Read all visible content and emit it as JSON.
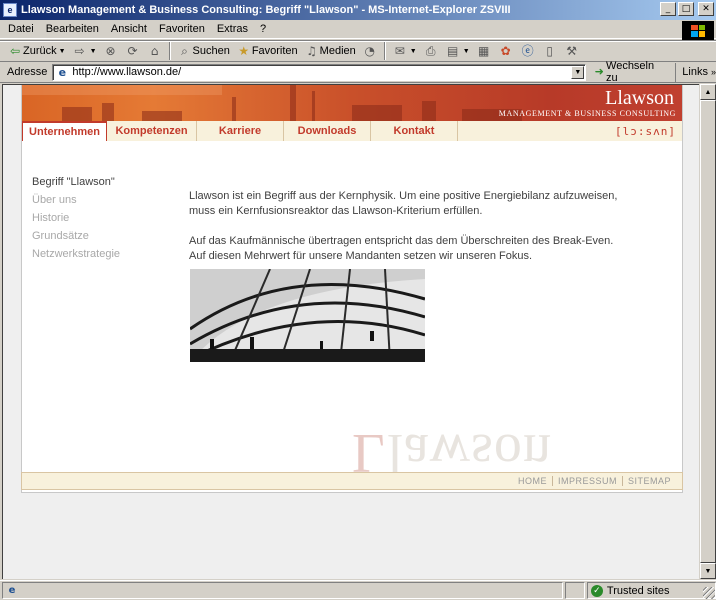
{
  "window": {
    "title": "Llawson Management & Business Consulting: Begriff \"Llawson\" - MS-Internet-Explorer ZSVIII"
  },
  "menu": [
    "Datei",
    "Bearbeiten",
    "Ansicht",
    "Favoriten",
    "Extras",
    "?"
  ],
  "toolbar": {
    "back_label": "Zurück",
    "search_label": "Suchen",
    "favorites_label": "Favoriten",
    "media_label": "Medien"
  },
  "address": {
    "label": "Adresse",
    "url": "http://www.llawson.de/",
    "go_label": "Wechseln zu",
    "links_label": "Links"
  },
  "site": {
    "brand": "Llawson",
    "tagline": "MANAGEMENT & BUSINESS CONSULTING",
    "logo_mark": "[lɔ:sʌn]",
    "nav": [
      {
        "label": "Unternehmen",
        "active": true
      },
      {
        "label": "Kompetenzen",
        "active": false
      },
      {
        "label": "Karriere",
        "active": false
      },
      {
        "label": "Downloads",
        "active": false
      },
      {
        "label": "Kontakt",
        "active": false
      }
    ],
    "subnav": [
      {
        "label": "Begriff \"Llawson\"",
        "current": true
      },
      {
        "label": "Über uns",
        "current": false
      },
      {
        "label": "Historie",
        "current": false
      },
      {
        "label": "Grundsätze",
        "current": false
      },
      {
        "label": "Netzwerkstrategie",
        "current": false
      }
    ],
    "paragraphs": [
      "Llawson ist ein Begriff aus der Kernphysik. Um eine positive Energiebilanz aufzuweisen, muss ein Kernfusionsreaktor das Llawson-Kriterium erfüllen.",
      "Auf das Kaufmännische übertragen entspricht das dem Überschreiten des Break-Even. Auf diesen Mehrwert für unsere Mandanten setzen wir unseren Fokus."
    ],
    "watermark_first": "L",
    "watermark_rest": "lawson",
    "footer": [
      "HOME",
      "IMPRESSUM",
      "SITEMAP"
    ]
  },
  "status": {
    "zone": "Trusted sites"
  },
  "colors": {
    "accent": "#c23a2b",
    "nav_bg": "#f8f1dc",
    "title_bar": "#0a246a"
  }
}
